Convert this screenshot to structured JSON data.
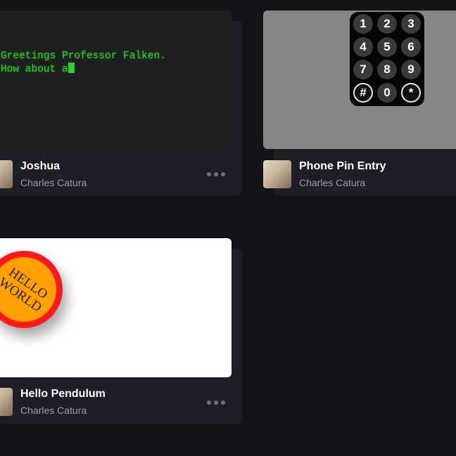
{
  "cards": [
    {
      "title": "Joshua",
      "author": "Charles Catura",
      "terminal_lines": [
        "Greetings Professor Falken.",
        "How about a"
      ]
    },
    {
      "title": "Phone Pin Entry",
      "author": "Charles Catura",
      "keypad": [
        "1",
        "2",
        "3",
        "4",
        "5",
        "6",
        "7",
        "8",
        "9",
        "#",
        "0",
        "*"
      ]
    },
    {
      "title": "Hello Pendulum",
      "author": "Charles Catura",
      "badge_lines": [
        "HELLO",
        "WORLD"
      ]
    }
  ],
  "colors": {
    "page_bg": "#131417",
    "card_bg": "#1e1f26",
    "terminal_text": "#2fd02f",
    "badge_outer": "#ff1a1a",
    "badge_inner": "#ff9f00"
  },
  "icons": [
    "more-options-icon",
    "avatar"
  ]
}
